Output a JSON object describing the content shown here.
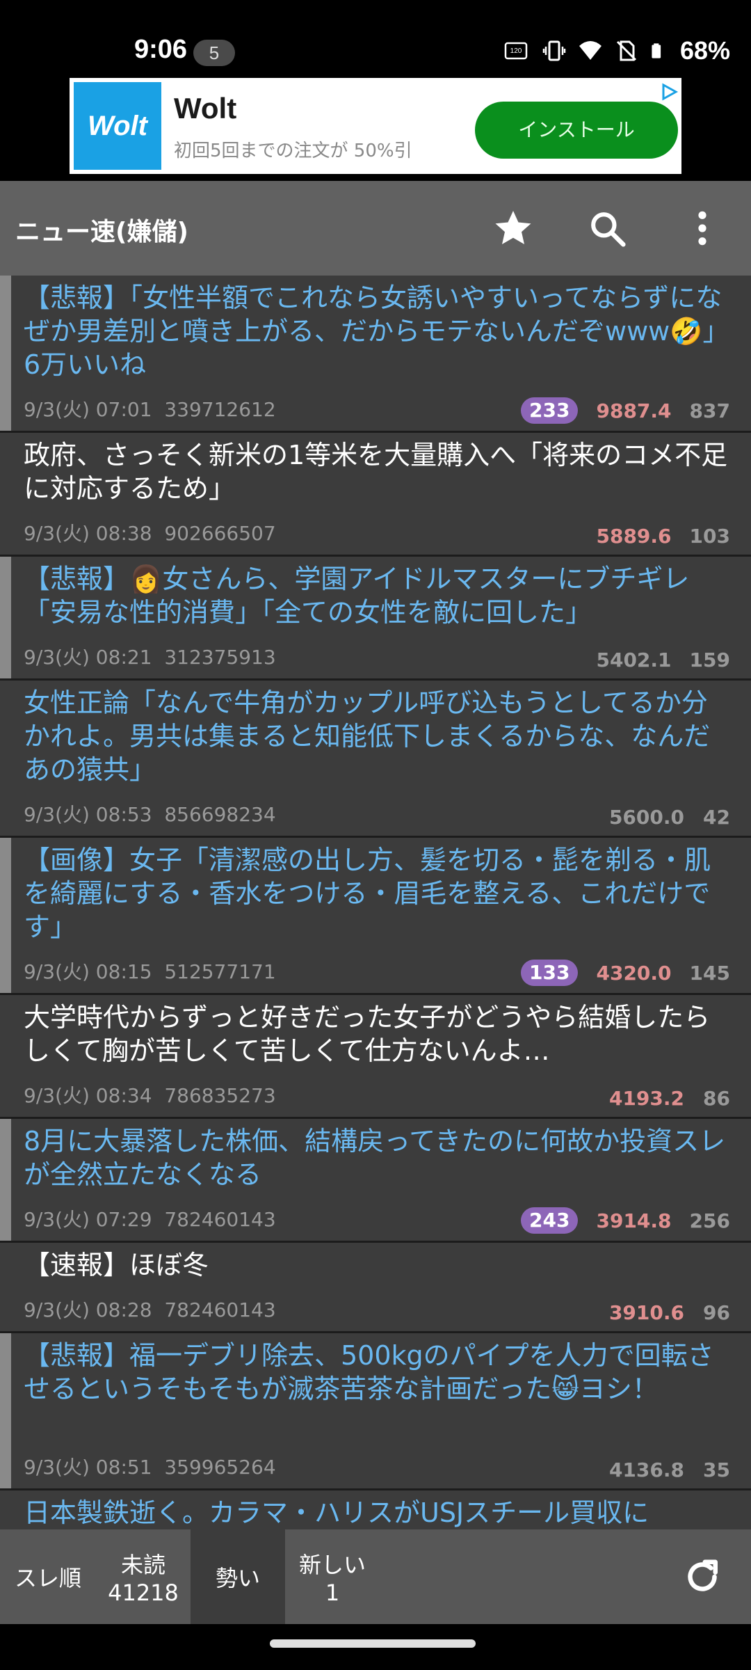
{
  "status": {
    "time": "9:06",
    "notif_count": "5",
    "battery": "68%"
  },
  "ad": {
    "logo": "Wolt",
    "title": "Wolt",
    "subtitle": "初回5回までの注文が 50%引",
    "button": "インストール"
  },
  "appbar": {
    "title": "ニュー速(嫌儲)",
    "icons": [
      "star-icon",
      "search-icon",
      "more-vert-icon"
    ]
  },
  "threads": [
    {
      "title": "【悲報】「女性半額でこれなら女誘いやすいってならずになぜか男差別と噴き上がる、だからモテないんだぞwww🤣」6万いいね",
      "date": "9/3(火) 07:01",
      "id": "339712612",
      "badge": "233",
      "ikioi": "9887.4",
      "count": "837",
      "blue": true,
      "bar": true
    },
    {
      "title": "政府、さっそく新米の1等米を大量購入へ「将来のコメ不足に対応するため」",
      "date": "9/3(火) 08:38",
      "id": "902666507",
      "badge": "",
      "ikioi": "5889.6",
      "count": "103",
      "blue": false,
      "bar": false
    },
    {
      "title": "【悲報】👩女さんら、学園アイドルマスターにブチギレ 「安易な性的消費」「全ての女性を敵に回した」",
      "date": "9/3(火) 08:21",
      "id": "312375913",
      "badge": "",
      "ikioi": "5402.1",
      "count": "159",
      "blue": true,
      "bar": true
    },
    {
      "title": "女性正論「なんで牛角がカップル呼び込もうとしてるか分かれよ。男共は集まると知能低下しまくるからな、なんだあの猿共」",
      "date": "9/3(火) 08:53",
      "id": "856698234",
      "badge": "",
      "ikioi": "5600.0",
      "count": "42",
      "blue": true,
      "bar": false
    },
    {
      "title": "【画像】女子「清潔感の出し方、髪を切る・髭を剃る・肌を綺麗にする・香水をつける・眉毛を整える、これだけです」",
      "date": "9/3(火) 08:15",
      "id": "512577171",
      "badge": "133",
      "ikioi": "4320.0",
      "count": "145",
      "blue": true,
      "bar": true
    },
    {
      "title": "大学時代からずっと好きだった女子がどうやら結婚したらしくて胸が苦しくて苦しくて仕方ないんよ…",
      "date": "9/3(火) 08:34",
      "id": "786835273",
      "badge": "",
      "ikioi": "4193.2",
      "count": "86",
      "blue": false,
      "bar": false
    },
    {
      "title": "8月に大暴落した株価、結構戻ってきたのに何故か投資スレが全然立たなくなる",
      "date": "9/3(火) 07:29",
      "id": "782460143",
      "badge": "243",
      "ikioi": "3914.8",
      "count": "256",
      "blue": true,
      "bar": true
    },
    {
      "title": "【速報】ほぼ冬",
      "date": "9/3(火) 08:28",
      "id": "782460143",
      "badge": "",
      "ikioi": "3910.6",
      "count": "96",
      "blue": false,
      "bar": false
    },
    {
      "title": "【悲報】福一デブリ除去、500kgのパイプを人力で回転させるというそもそもが滅茶苦茶な計画だった😸ヨシ！",
      "date": "9/3(火) 08:51",
      "id": "359965264",
      "badge": "",
      "ikioi": "4136.8",
      "count": "35",
      "blue": true,
      "bar": true
    },
    {
      "title": "日本製鉄逝く。カラマ・ハリスがUSJスチール買収に",
      "date": "",
      "id": "",
      "badge": "",
      "ikioi": "",
      "count": "",
      "blue": true,
      "bar": false
    }
  ],
  "tabs": {
    "sort_order": "スレ順",
    "unread_label": "未読",
    "unread_count": "41218",
    "momentum": "勢い",
    "newest_label": "新しい",
    "newest_count": "1"
  },
  "colors": {
    "appbar": "#616161",
    "list_bg": "#3c3c3c",
    "link_blue": "#6ab8f0",
    "ikioi_red": "#e08f8f",
    "badge_purple": "#8d66b8",
    "install_green": "#0a8f1d"
  }
}
